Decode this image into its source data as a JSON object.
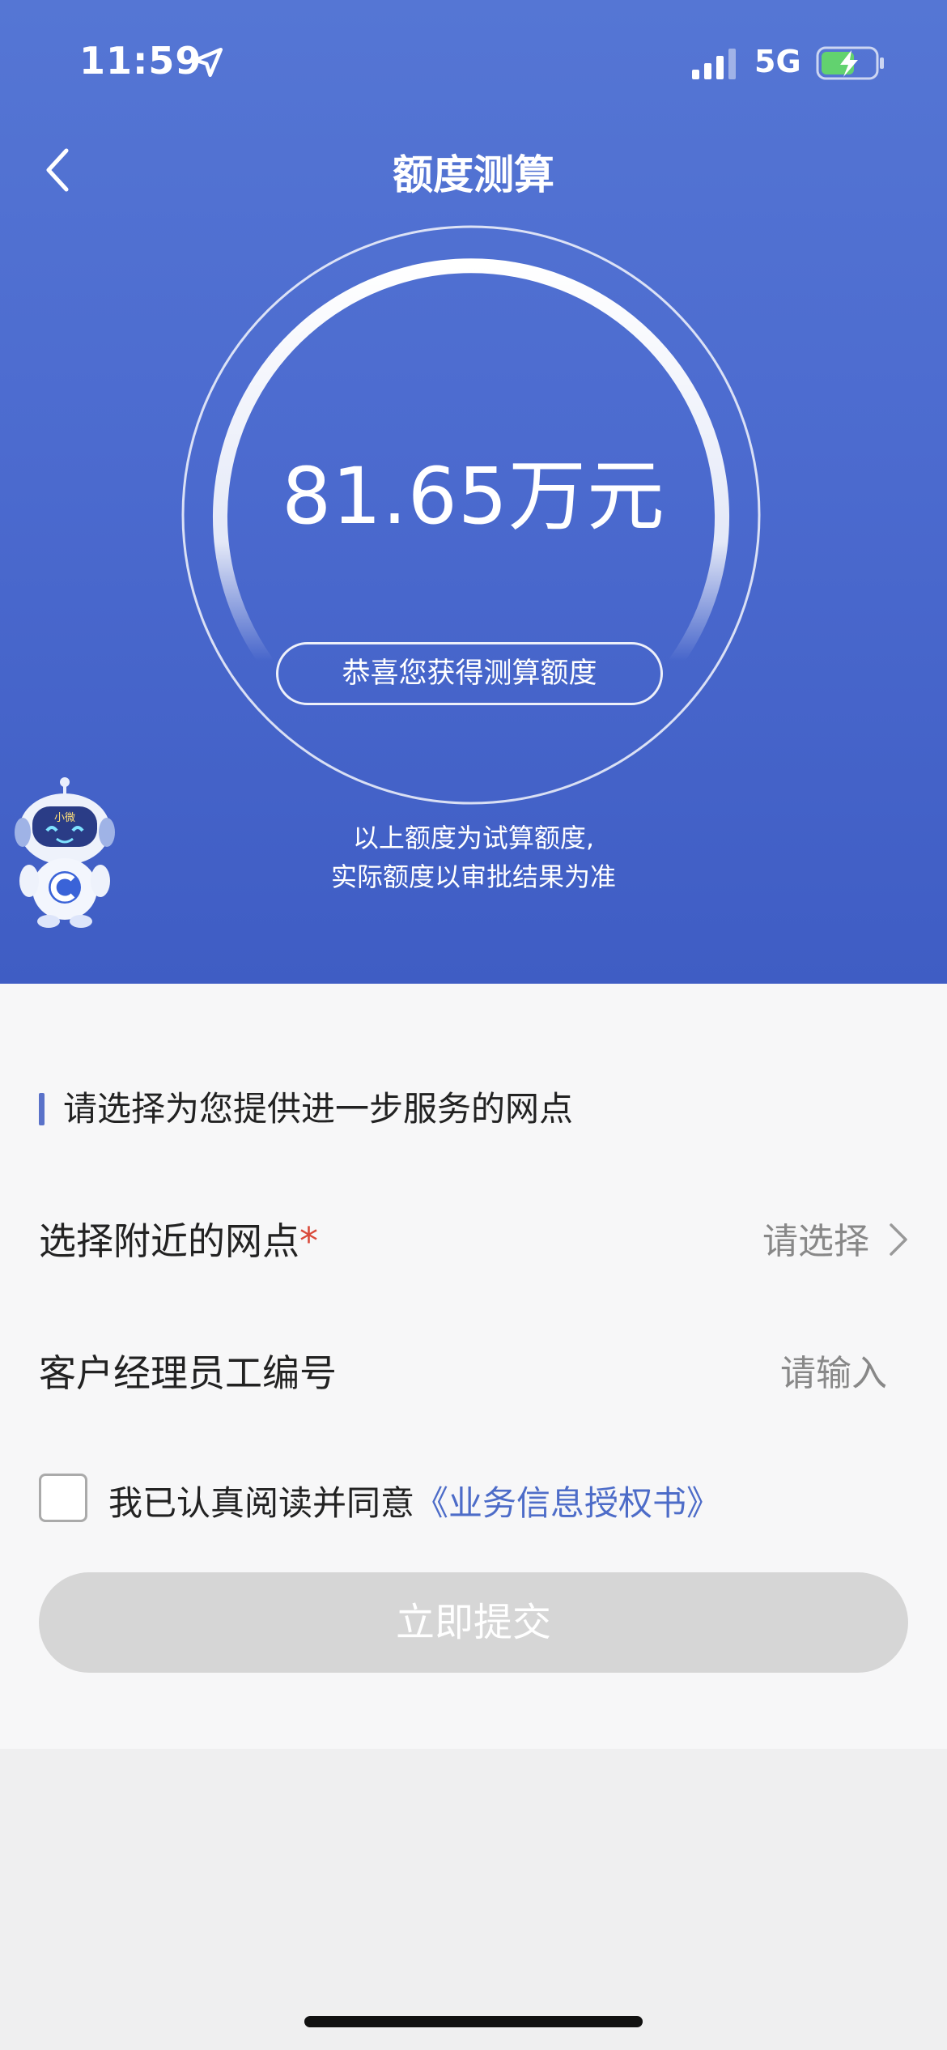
{
  "status_bar": {
    "time": "11:59",
    "network": "5G",
    "icons": [
      "location-arrow-icon",
      "signal-icon",
      "battery-charging-icon"
    ]
  },
  "nav": {
    "title": "额度测算",
    "back_icon": "chevron-left-icon"
  },
  "result": {
    "amount": "81.65万元",
    "congrats": "恭喜您获得测算额度",
    "note_line1": "以上额度为试算额度,",
    "note_line2": "实际额度以审批结果为准",
    "mascot_badge": "小微"
  },
  "form": {
    "section_title": "请选择为您提供进一步服务的网点",
    "branch_label": "选择附近的网点",
    "branch_required_mark": "*",
    "branch_placeholder": "请选择",
    "manager_label": "客户经理员工编号",
    "manager_placeholder": "请输入",
    "agreement_text": "我已认真阅读并同意",
    "agreement_link": "《业务信息授权书》",
    "submit_label": "立即提交"
  },
  "colors": {
    "header_blue": "#4c6bcf",
    "link_blue": "#4d6cc8",
    "required_red": "#d94a3b",
    "disabled_button": "#d6d6d6"
  }
}
